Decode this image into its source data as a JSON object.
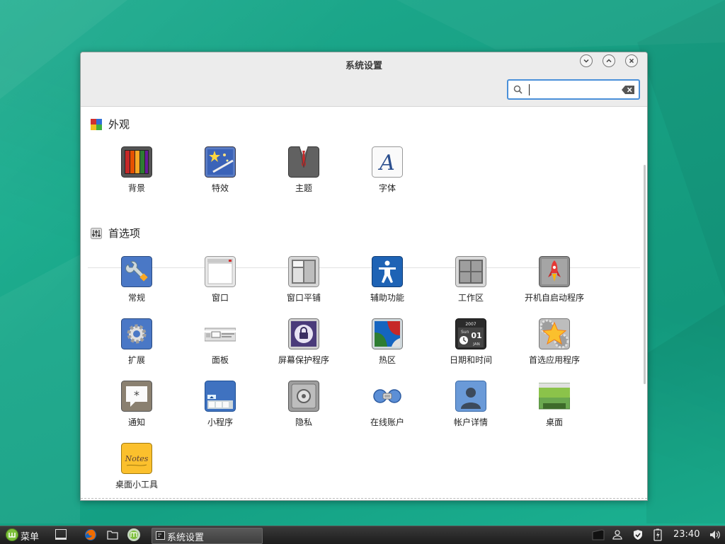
{
  "window": {
    "title": "系统设置",
    "search": {
      "placeholder": "",
      "value": ""
    }
  },
  "sections": [
    {
      "title": "外观",
      "items": [
        {
          "label": "背景",
          "icon": "background-icon"
        },
        {
          "label": "特效",
          "icon": "effects-icon"
        },
        {
          "label": "主题",
          "icon": "themes-icon"
        },
        {
          "label": "字体",
          "icon": "fonts-icon"
        }
      ]
    },
    {
      "title": "首选项",
      "items": [
        {
          "label": "常规",
          "icon": "general-icon"
        },
        {
          "label": "窗口",
          "icon": "windows-icon"
        },
        {
          "label": "窗口平铺",
          "icon": "window-tiling-icon"
        },
        {
          "label": "辅助功能",
          "icon": "accessibility-icon"
        },
        {
          "label": "工作区",
          "icon": "workspaces-icon"
        },
        {
          "label": "开机自启动程序",
          "icon": "startup-apps-icon"
        },
        {
          "label": "扩展",
          "icon": "extensions-icon"
        },
        {
          "label": "面板",
          "icon": "panel-icon"
        },
        {
          "label": "屏幕保护程序",
          "icon": "screensaver-icon"
        },
        {
          "label": "热区",
          "icon": "hot-corners-icon"
        },
        {
          "label": "日期和时间",
          "icon": "date-time-icon"
        },
        {
          "label": "首选应用程序",
          "icon": "preferred-apps-icon"
        },
        {
          "label": "通知",
          "icon": "notifications-icon"
        },
        {
          "label": "小程序",
          "icon": "applets-icon"
        },
        {
          "label": "隐私",
          "icon": "privacy-icon"
        },
        {
          "label": "在线账户",
          "icon": "online-accounts-icon"
        },
        {
          "label": "帐户详情",
          "icon": "account-details-icon"
        },
        {
          "label": "桌面",
          "icon": "desktop-icon"
        },
        {
          "label": "桌面小工具",
          "icon": "desklets-icon"
        }
      ]
    }
  ],
  "icon_text": {
    "date_year": "2007",
    "date_weekday": "Sun",
    "date_day": "01",
    "date_month": "JAN",
    "notes": "Notes"
  },
  "taskbar": {
    "menu_label": "菜单",
    "task_label": "系统设置",
    "clock": "23:40"
  },
  "colors": {
    "accent": "#4a90d9",
    "desktop": "#17a688",
    "taskbar": "#2a2a2a"
  }
}
